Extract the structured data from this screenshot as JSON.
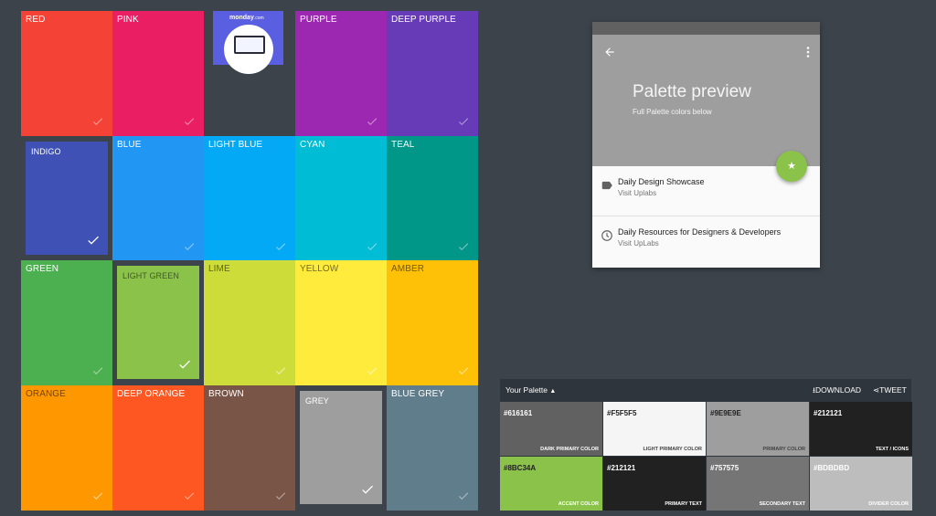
{
  "colors": [
    {
      "name": "RED",
      "hex": "#f44336",
      "text": "light",
      "selected": false
    },
    {
      "name": "PINK",
      "hex": "#e91e63",
      "text": "light",
      "selected": false
    },
    {
      "name": "PURPLE",
      "hex": "#9c27b0",
      "text": "light",
      "selected": false
    },
    {
      "name": "DEEP PURPLE",
      "hex": "#673ab7",
      "text": "light",
      "selected": false
    },
    {
      "name": "INDIGO",
      "hex": "#3f51b5",
      "text": "light",
      "selected": true
    },
    {
      "name": "BLUE",
      "hex": "#2196f3",
      "text": "light",
      "selected": false
    },
    {
      "name": "LIGHT BLUE",
      "hex": "#03a9f4",
      "text": "light",
      "selected": false
    },
    {
      "name": "CYAN",
      "hex": "#00bcd4",
      "text": "light",
      "selected": false
    },
    {
      "name": "TEAL",
      "hex": "#009688",
      "text": "light",
      "selected": false
    },
    {
      "name": "GREEN",
      "hex": "#4caf50",
      "text": "light",
      "selected": false
    },
    {
      "name": "LIGHT GREEN",
      "hex": "#8bc34a",
      "text": "dark",
      "selected": true
    },
    {
      "name": "LIME",
      "hex": "#cddc39",
      "text": "dark",
      "selected": false
    },
    {
      "name": "YELLOW",
      "hex": "#ffeb3b",
      "text": "dark",
      "selected": false
    },
    {
      "name": "AMBER",
      "hex": "#ffc107",
      "text": "dark",
      "selected": false
    },
    {
      "name": "ORANGE",
      "hex": "#ff9800",
      "text": "dark",
      "selected": false
    },
    {
      "name": "DEEP ORANGE",
      "hex": "#ff5722",
      "text": "light",
      "selected": false
    },
    {
      "name": "BROWN",
      "hex": "#795548",
      "text": "light",
      "selected": false
    },
    {
      "name": "GREY",
      "hex": "#9e9e9e",
      "text": "light",
      "selected": true
    },
    {
      "name": "BLUE GREY",
      "hex": "#607d8b",
      "text": "light",
      "selected": false
    }
  ],
  "ad": {
    "logo": "monday",
    "logo_suffix": ".com"
  },
  "preview": {
    "title": "Palette preview",
    "subtitle": "Full Palette colors below",
    "fab_icon": "★",
    "items": [
      {
        "title": "Daily Design Showcase",
        "subtitle": "Visit Uplabs",
        "icon": "label-icon"
      },
      {
        "title": "Daily Resources for Designers & Developers",
        "subtitle": "Visit UpLabs",
        "icon": "clock-icon"
      }
    ]
  },
  "palette": {
    "label": "Your Palette",
    "download": "DOWNLOAD",
    "tweet": "TWEET",
    "swatches": [
      {
        "hex": "#616161",
        "role": "DARK PRIMARY COLOR",
        "hex_color": "#ffffff",
        "role_color": "#ffffff"
      },
      {
        "hex": "#F5F5F5",
        "role": "LIGHT PRIMARY COLOR",
        "hex_color": "#212121",
        "role_color": "#424242"
      },
      {
        "hex": "#9E9E9E",
        "role": "PRIMARY COLOR",
        "hex_color": "#212121",
        "role_color": "#424242"
      },
      {
        "hex": "#212121",
        "role": "TEXT / ICONS",
        "hex_color": "#ffffff",
        "role_color": "#ffffff"
      },
      {
        "hex": "#8BC34A",
        "role": "ACCENT COLOR",
        "hex_color": "#212121",
        "role_color": "#ffffff"
      },
      {
        "hex": "#212121",
        "role": "PRIMARY TEXT",
        "hex_color": "#ffffff",
        "role_color": "#ffffff"
      },
      {
        "hex": "#757575",
        "role": "SECONDARY TEXT",
        "hex_color": "#ffffff",
        "role_color": "#ffffff"
      },
      {
        "hex": "#BDBDBD",
        "role": "DIVIDER COLOR",
        "hex_color": "#ffffff",
        "role_color": "#ffffff"
      }
    ]
  }
}
